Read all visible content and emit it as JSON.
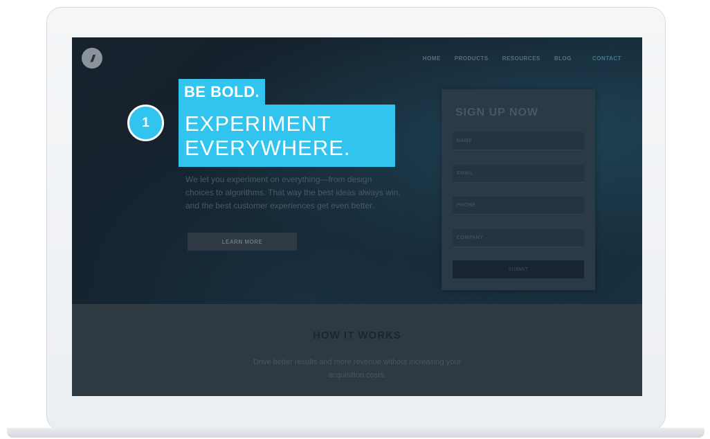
{
  "logo": {
    "text": "//"
  },
  "nav": {
    "items": [
      {
        "label": "HOME"
      },
      {
        "label": "PRODUCTS"
      },
      {
        "label": "RESOURCES"
      },
      {
        "label": "BLOG"
      }
    ],
    "contact": "CONTACT"
  },
  "hero": {
    "tagline": "BE BOLD.",
    "headline_line1": "EXPERIMENT",
    "headline_line2": "EVERYWHERE.",
    "body": "We let you experiment on everything—from design choices to algorithms. That way the best ideas always win, and the best customer experiences get even better.",
    "cta": "LEARN MORE"
  },
  "step_badge": "1",
  "signup": {
    "title": "SIGN UP NOW",
    "fields": [
      {
        "label": "NAME"
      },
      {
        "label": "EMAIL"
      },
      {
        "label": "PHONE"
      },
      {
        "label": "COMPANY"
      }
    ],
    "submit": "SUBMIT"
  },
  "how": {
    "title": "HOW IT WORKS",
    "body": "Drive better results and more revenue without increasing your acquisition costs."
  },
  "colors": {
    "accent": "#30c4ee",
    "overlay": "#121c26"
  }
}
